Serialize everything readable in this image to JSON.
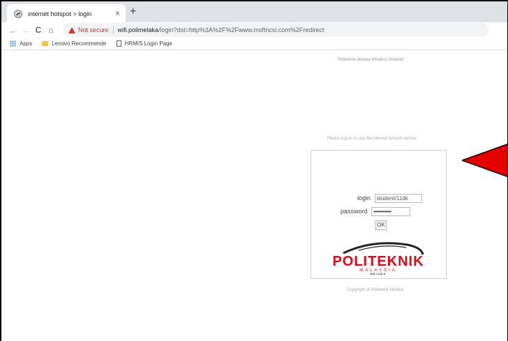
{
  "browser": {
    "tab": {
      "title": "internet hotspot > login",
      "close_glyph": "×",
      "favicon": "globe-icon"
    },
    "new_tab_glyph": "+",
    "toolbar": {
      "back_glyph": "←",
      "forward_glyph": "→",
      "reload_glyph": "C",
      "home_glyph": "⌂",
      "security_label": "Not secure",
      "url_host": "wifi.polimelaka",
      "url_rest": "/login?dst=http%3A%2F%2Fwww.msftncsi.com%2Fredirect"
    },
    "bookmarks": [
      {
        "label": "Apps",
        "icon": "apps-grid-icon"
      },
      {
        "label": "Lenovo Recommende",
        "icon": "folder-icon"
      },
      {
        "label": "HRMIS Login Page",
        "icon": "page-icon"
      }
    ]
  },
  "page": {
    "header": "Politeknik Melaka Wireless Network",
    "prompt": "Please log on to use the internet hotspot service",
    "form": {
      "login_label": "login",
      "login_value": "student/11dk",
      "password_label": "password",
      "password_value": "••••••••••••••",
      "ok_label": "OK"
    },
    "logo": {
      "main": "POLITEKNIK",
      "sub": "MALAYSIA",
      "sub2": "MELAKA"
    },
    "copyright": "Copyright of Politeknik Melaka"
  },
  "colors": {
    "logo_red": "#e30613",
    "warning_red": "#d93025",
    "annotation_arrow": "#e50000"
  }
}
